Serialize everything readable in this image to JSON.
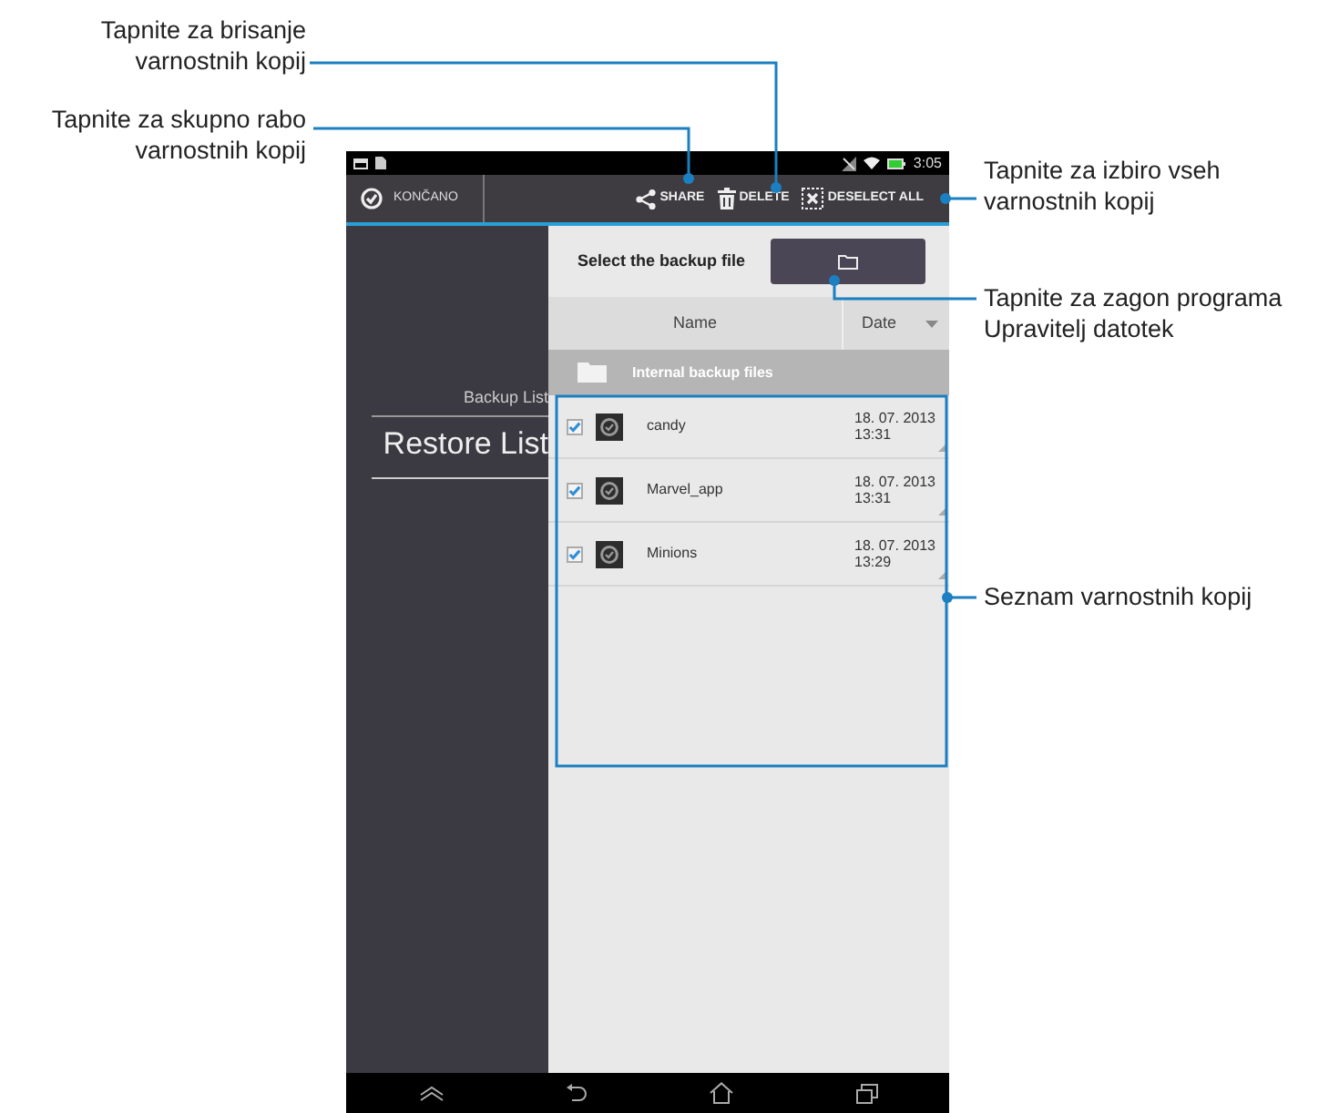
{
  "callouts": [
    {
      "text": "Tapnite za brisanje varnostnih kopij"
    },
    {
      "text": "Tapnite za skupno rabo varnostnih kopij"
    },
    {
      "text": "Tapnite za izbiro vseh varnostnih kopij"
    },
    {
      "text": "Tapnite za zagon programa Upravitelj datotek"
    },
    {
      "text": "Seznam varnostnih kopij"
    }
  ],
  "status_bar": {
    "time": "3:05"
  },
  "action_bar": {
    "done": "KONČANO",
    "actions": [
      {
        "kind": "share",
        "label": "SHARE"
      },
      {
        "kind": "delete",
        "label": "DELETE"
      },
      {
        "kind": "deselect",
        "label": "DESELECT ALL"
      }
    ]
  },
  "sidebar": {
    "items": [
      {
        "label": "Backup List",
        "selected": false
      },
      {
        "label": "Restore List",
        "selected": true
      }
    ]
  },
  "select_file": {
    "label": "Select the backup file"
  },
  "table": {
    "columns": [
      "Name",
      "Date"
    ],
    "group": "Internal backup files",
    "rows": [
      {
        "name": "candy",
        "date": "18. 07. 2013",
        "time": "13:31",
        "checked": true
      },
      {
        "name": "Marvel_app",
        "date": "18. 07. 2013",
        "time": "13:31",
        "checked": true
      },
      {
        "name": "Minions",
        "date": "18. 07. 2013",
        "time": "13:29",
        "checked": true
      }
    ]
  }
}
